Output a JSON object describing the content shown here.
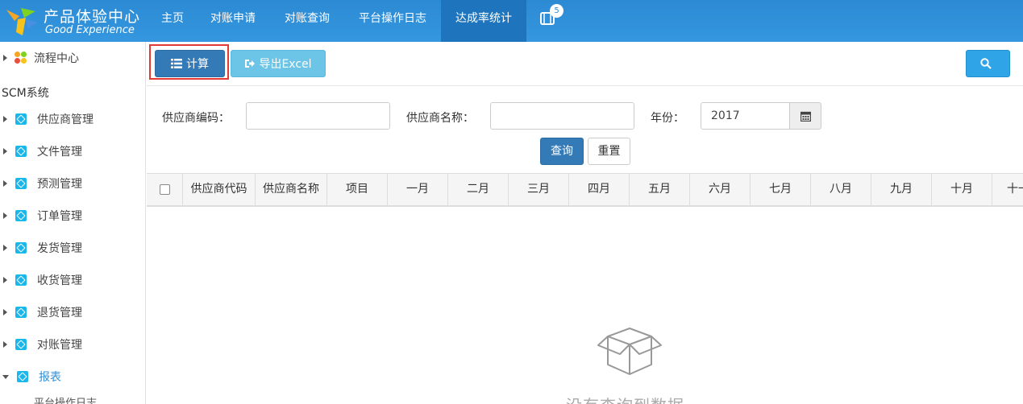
{
  "header": {
    "logo_cn": "产品体验中心",
    "logo_en": "Good Experience",
    "nav": [
      {
        "label": "主页"
      },
      {
        "label": "对账申请"
      },
      {
        "label": "对账查询"
      },
      {
        "label": "平台操作日志"
      },
      {
        "label": "达成率统计",
        "active": true
      }
    ],
    "notify_count": "5"
  },
  "sidebar": {
    "flow_center": "流程中心",
    "section_title": "SCM系统",
    "items": [
      {
        "label": "供应商管理",
        "icon": "cube-icon"
      },
      {
        "label": "文件管理",
        "icon": "cube-icon"
      },
      {
        "label": "预测管理",
        "icon": "cube-icon"
      },
      {
        "label": "订单管理",
        "icon": "cube-icon"
      },
      {
        "label": "发货管理",
        "icon": "cube-icon"
      },
      {
        "label": "收货管理",
        "icon": "cube-icon"
      },
      {
        "label": "退货管理",
        "icon": "cube-icon"
      },
      {
        "label": "对账管理",
        "icon": "cube-icon"
      },
      {
        "label": "报表",
        "icon": "cube-icon",
        "expanded": true
      }
    ],
    "subitem_partial": "平台操作日志"
  },
  "toolbar": {
    "calc_label": "计算",
    "export_label": "导出Excel"
  },
  "form": {
    "supplier_code_label": "供应商编码：",
    "supplier_code_value": "",
    "supplier_name_label": "供应商名称：",
    "supplier_name_value": "",
    "year_label": "年份：",
    "year_value": "2017",
    "query_label": "查询",
    "reset_label": "重置"
  },
  "table": {
    "columns": [
      "供应商代码",
      "供应商名称",
      "项目",
      "一月",
      "二月",
      "三月",
      "四月",
      "五月",
      "六月",
      "七月",
      "八月",
      "九月",
      "十月",
      "十一月"
    ]
  },
  "empty_state": {
    "text": "没有查询到数据"
  },
  "colors": {
    "topbar": "#2f8fd8",
    "primary": "#337ab7",
    "export": "#6cc4e6",
    "highlight": "#e53935",
    "sidebar_icon": "#1ab7ea"
  }
}
